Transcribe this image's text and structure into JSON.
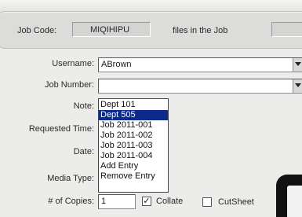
{
  "header": {
    "job_code_label": "Job Code:",
    "job_code_value": "MIQIHIPU",
    "files_label": "files in the Job"
  },
  "form": {
    "username_label": "Username:",
    "username_value": "ABrown",
    "job_number_label": "Job Number:",
    "job_number_value": "",
    "note_label": "Note:",
    "requested_time_label": "Requested Time:",
    "date_label": "Date:",
    "media_type_label": "Media Type:",
    "copies_label": "# of Copies:",
    "copies_value": "1",
    "collate_label": "Collate",
    "collate_checked": "✓",
    "cutsheet_label": "CutSheet"
  },
  "note_dropdown": {
    "options": [
      "Dept 101",
      "Dept 505",
      "Job 2011-001",
      "Job 2011-002",
      "Job 2011-003",
      "Job 2011-004",
      "Add Entry",
      "Remove Entry"
    ],
    "selected": "Dept 505",
    "highlight_color": "#0b2a8a"
  }
}
